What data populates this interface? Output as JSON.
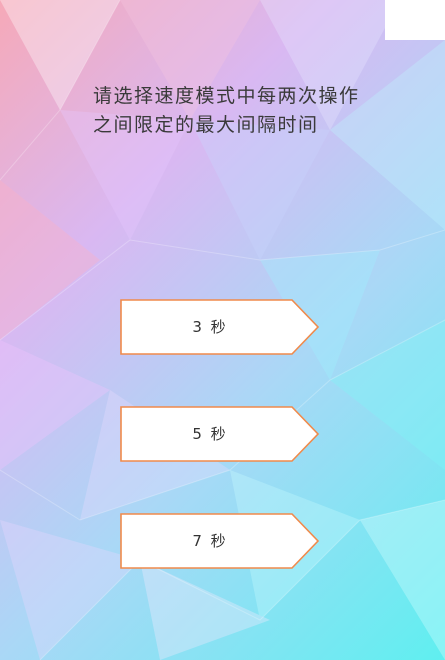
{
  "question": {
    "text": "请选择速度模式中每两次操作之间限定的最大间隔时间"
  },
  "options": [
    {
      "label": "3 秒"
    },
    {
      "label": "5 秒"
    },
    {
      "label": "7 秒"
    }
  ],
  "colors": {
    "option_border": "#f08a4b",
    "option_fill": "#ffffff",
    "question_text": "#3a3a3a"
  }
}
